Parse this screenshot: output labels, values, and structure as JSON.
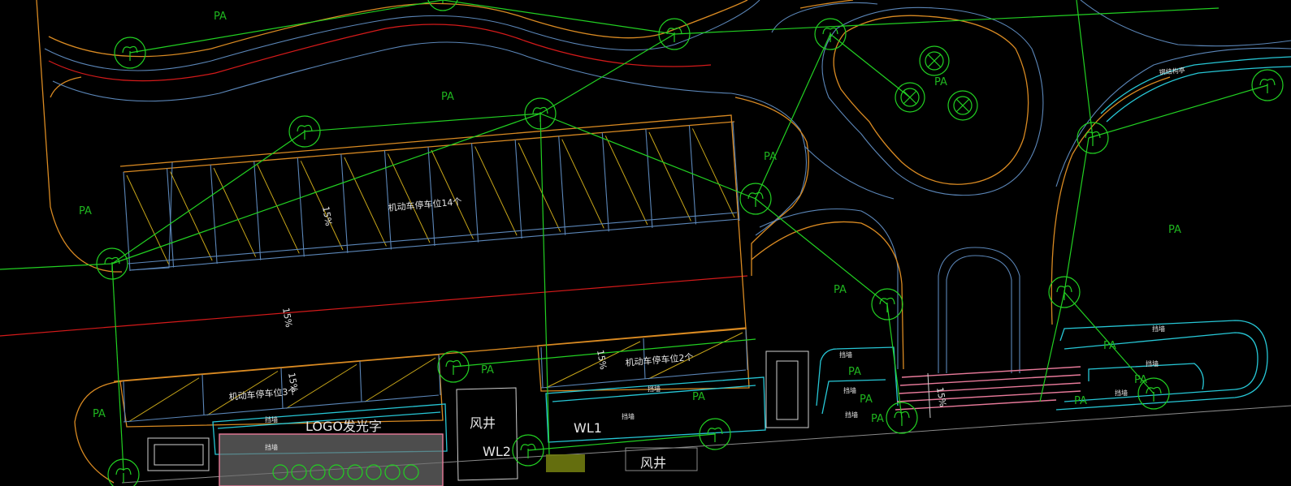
{
  "diagram": {
    "area_labels": [
      "PA",
      "PA",
      "PA",
      "PA",
      "PA",
      "PA",
      "PA",
      "PA",
      "PA",
      "PA",
      "PA",
      "PA",
      "PA",
      "PA",
      "PA",
      "PA"
    ],
    "parking_large": "机动车停车位14个",
    "parking_left": "机动车停车位3个",
    "parking_right": "机动车停车位2个",
    "slope_label": "15%",
    "logo_sign": "LOGO发光字",
    "vent_shaft": "风井",
    "wl1": "WL1",
    "wl2": "WL2",
    "wall_label": "挡墙",
    "steps_label": "钢结构亭"
  },
  "colors": {
    "boundary": "#d98a22",
    "road_edge": "#5b86b8",
    "wall": "#27c7d6",
    "redline": "#d41a1a",
    "trees": "#22d022",
    "hatch": "#c8a619"
  }
}
